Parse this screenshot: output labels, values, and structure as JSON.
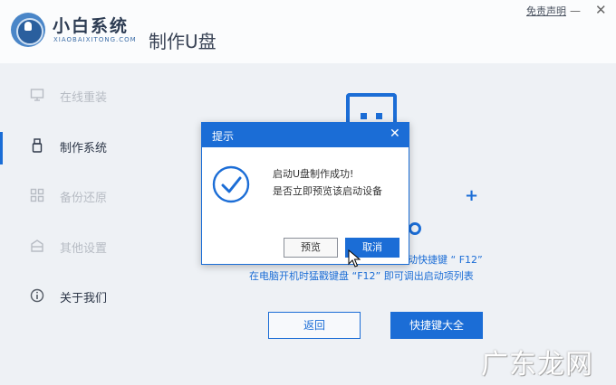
{
  "app": {
    "logo_name": "小白系统",
    "logo_sub": "XIAOBAIXITONG.COM",
    "page_title": "制作U盘",
    "disclaimer": "免责声明",
    "minimize": "—",
    "close": "✕"
  },
  "sidebar": {
    "items": [
      {
        "label": "在线重装",
        "icon": "monitor-icon",
        "active": false
      },
      {
        "label": "制作系统",
        "icon": "usb-icon",
        "active": true
      },
      {
        "label": "备份还原",
        "icon": "grid-icon",
        "active": false
      },
      {
        "label": "其他设置",
        "icon": "box-icon",
        "active": false
      },
      {
        "label": "关于我们",
        "icon": "info-icon",
        "active": false
      }
    ]
  },
  "main": {
    "hint1": "动快捷键 “ F12”",
    "hint2": "在电脑开机时猛戳键盘 “F12” 即可调出启动项列表",
    "back_label": "返回",
    "shortcuts_label": "快捷键大全"
  },
  "dialog": {
    "title": "提示",
    "close": "✕",
    "message_line1": "启动U盘制作成功!",
    "message_line2": "是否立即预览该启动设备",
    "preview_label": "预览",
    "cancel_label": "取消"
  },
  "watermark": "广东龙网",
  "colors": {
    "accent": "#1b6dd6",
    "background": "#eef1f5"
  }
}
